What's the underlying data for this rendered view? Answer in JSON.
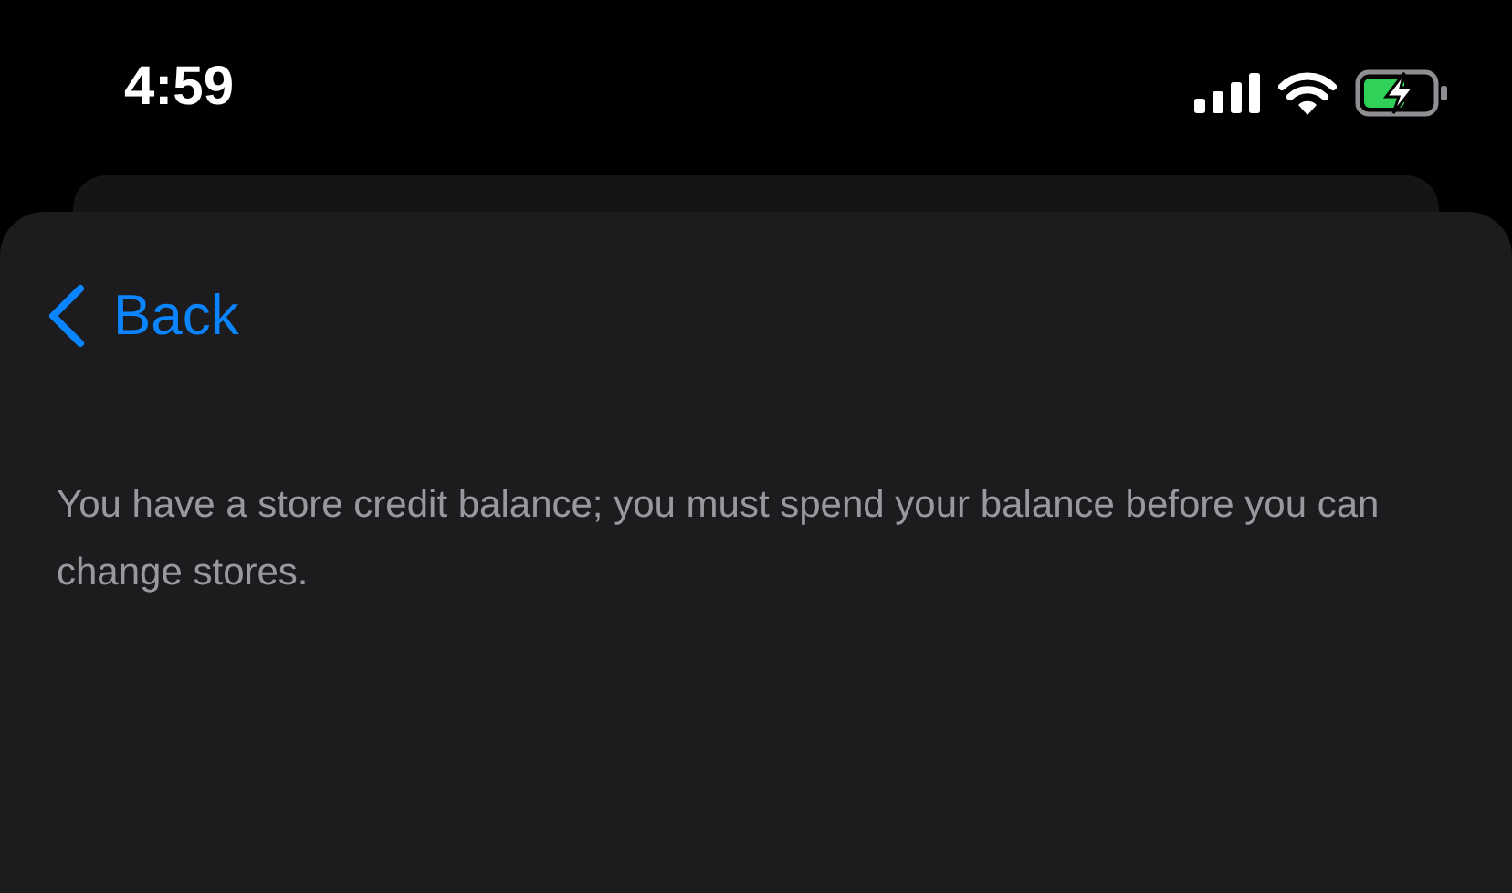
{
  "status_bar": {
    "time": "4:59"
  },
  "nav": {
    "back_label": "Back"
  },
  "message": "You have a store credit balance; you must spend your balance before you can change stores."
}
